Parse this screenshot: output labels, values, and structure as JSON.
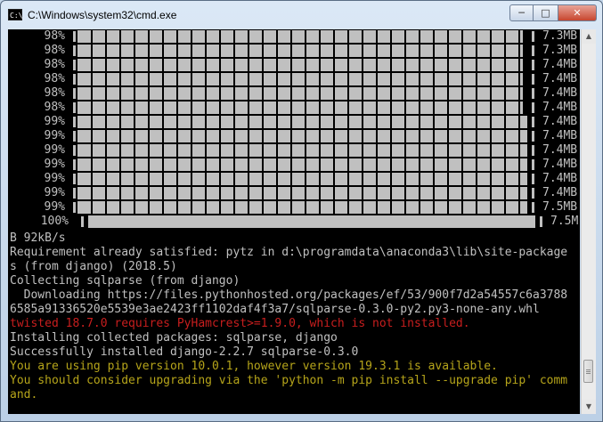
{
  "window": {
    "title": "C:\\Windows\\system32\\cmd.exe",
    "icon_label": "C:\\",
    "controls": {
      "minimize": "─",
      "maximize": "□",
      "close": "✕"
    }
  },
  "progress_rows": [
    {
      "percent": "98%",
      "size": "7.3MB",
      "fill": 0.98
    },
    {
      "percent": "98%",
      "size": "7.3MB",
      "fill": 0.98
    },
    {
      "percent": "98%",
      "size": "7.4MB",
      "fill": 0.98
    },
    {
      "percent": "98%",
      "size": "7.4MB",
      "fill": 0.98
    },
    {
      "percent": "98%",
      "size": "7.4MB",
      "fill": 0.98
    },
    {
      "percent": "98%",
      "size": "7.4MB",
      "fill": 0.98
    },
    {
      "percent": "99%",
      "size": "7.4MB",
      "fill": 0.99
    },
    {
      "percent": "99%",
      "size": "7.4MB",
      "fill": 0.99
    },
    {
      "percent": "99%",
      "size": "7.4MB",
      "fill": 0.99
    },
    {
      "percent": "99%",
      "size": "7.4MB",
      "fill": 0.99
    },
    {
      "percent": "99%",
      "size": "7.4MB",
      "fill": 0.99
    },
    {
      "percent": "99%",
      "size": "7.4MB",
      "fill": 0.99
    },
    {
      "percent": "99%",
      "size": "7.5MB",
      "fill": 0.99
    },
    {
      "percent": "100%",
      "size": "7.5M",
      "fill": 1.0
    }
  ],
  "console_lines": [
    {
      "text": "B 92kB/s",
      "color": "gray"
    },
    {
      "text": "Requirement already satisfied: pytz in d:\\programdata\\anaconda3\\lib\\site-package",
      "color": "gray"
    },
    {
      "text": "s (from django) (2018.5)",
      "color": "gray"
    },
    {
      "text": "Collecting sqlparse (from django)",
      "color": "gray"
    },
    {
      "text": "  Downloading https://files.pythonhosted.org/packages/ef/53/900f7d2a54557c6a3788",
      "color": "gray"
    },
    {
      "text": "6585a91336520e5539e3ae2423ff1102daf4f3a7/sqlparse-0.3.0-py2.py3-none-any.whl",
      "color": "gray"
    },
    {
      "text": "twisted 18.7.0 requires PyHamcrest>=1.9.0, which is not installed.",
      "color": "red"
    },
    {
      "text": "Installing collected packages: sqlparse, django",
      "color": "gray"
    },
    {
      "text": "Successfully installed django-2.2.7 sqlparse-0.3.0",
      "color": "gray"
    },
    {
      "text": "You are using pip version 10.0.1, however version 19.3.1 is available.",
      "color": "yellow"
    },
    {
      "text": "You should consider upgrading via the 'python -m pip install --upgrade pip' comm",
      "color": "yellow"
    },
    {
      "text": "and.",
      "color": "yellow"
    }
  ],
  "scrollbar": {
    "up": "▲",
    "down": "▼"
  },
  "colors": {
    "console_bg": "#000000",
    "text": "#c0c0c0",
    "error": "#c81e1e",
    "warning": "#b5a41a"
  }
}
